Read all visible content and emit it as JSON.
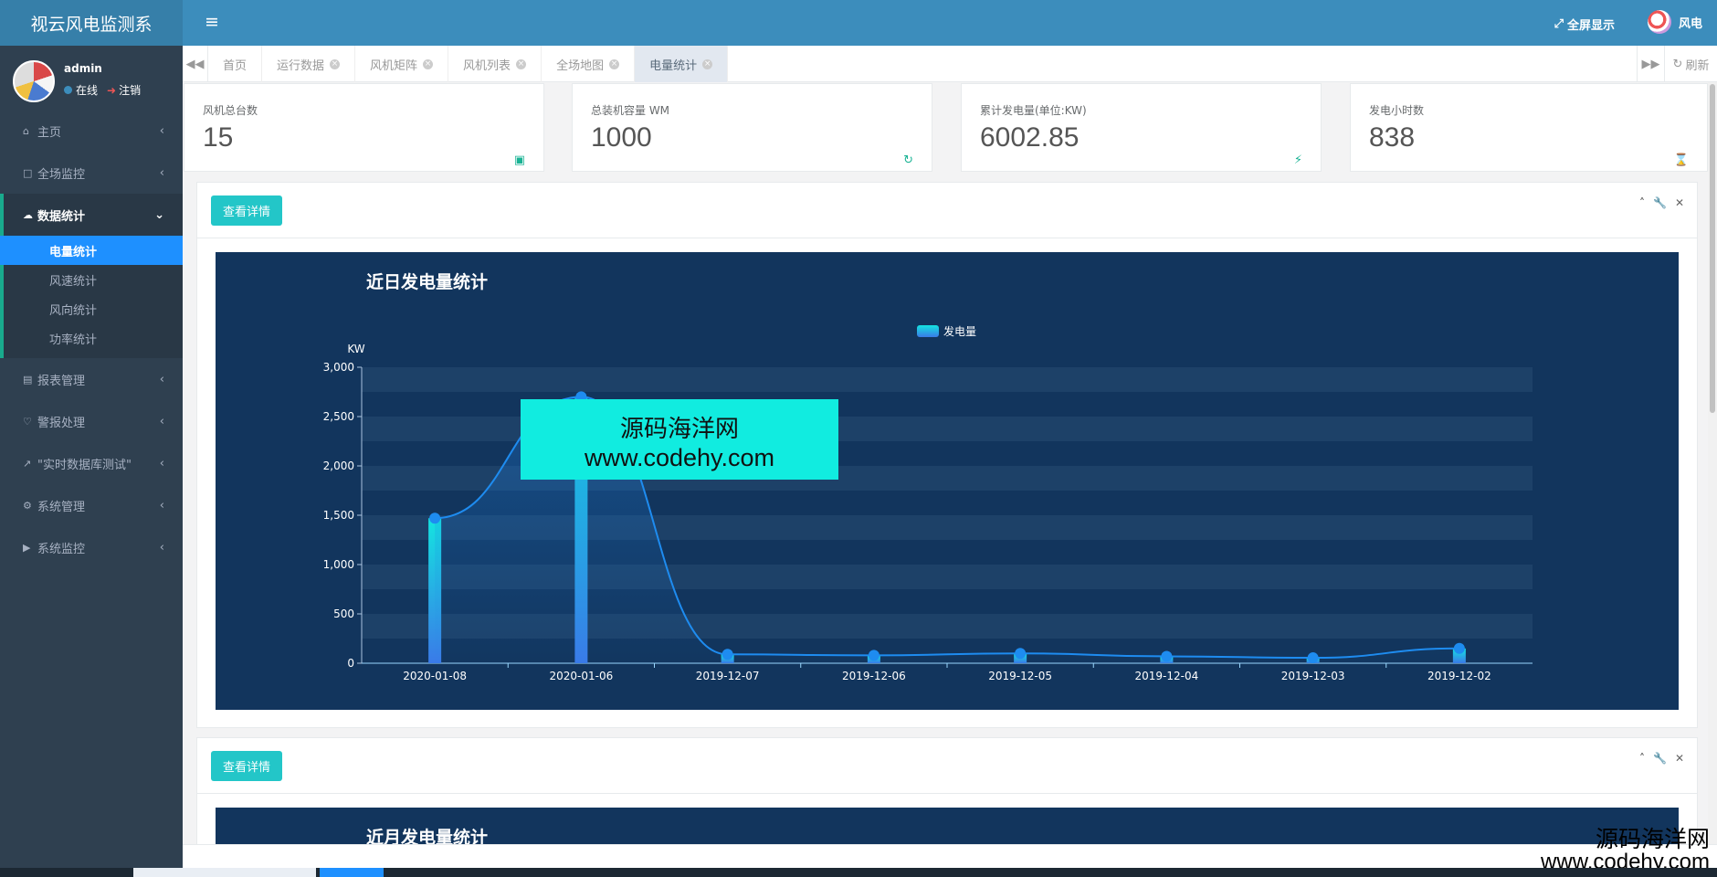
{
  "app": {
    "title": "视云风电监测系",
    "fullscreen_label": "全屏显示",
    "user_name": "风电"
  },
  "profile": {
    "name": "admin",
    "status": "在线",
    "logout": "注销"
  },
  "sidebar": {
    "items": [
      {
        "label": "主页",
        "icon": "home-icon"
      },
      {
        "label": "全场监控",
        "icon": "monitor-icon"
      },
      {
        "label": "数据统计",
        "icon": "cloud-icon",
        "active": true
      },
      {
        "label": "报表管理",
        "icon": "report-icon"
      },
      {
        "label": "警报处理",
        "icon": "bell-icon"
      },
      {
        "label": "\"实时数据库测试\"",
        "icon": "line-chart-icon"
      },
      {
        "label": "系统管理",
        "icon": "gear-icon"
      },
      {
        "label": "系统监控",
        "icon": "video-icon"
      }
    ],
    "sub_items": [
      "电量统计",
      "风速统计",
      "风向统计",
      "功率统计"
    ]
  },
  "tabs": [
    "首页",
    "运行数据",
    "风机矩阵",
    "风机列表",
    "全场地图",
    "电量统计"
  ],
  "refresh_label": "刷新",
  "stats": [
    {
      "label": "风机总台数",
      "value": "15",
      "icon": "image-icon"
    },
    {
      "label": "总装机容量 WM",
      "value": "1000",
      "icon": "refresh-icon"
    },
    {
      "label": "累计发电量(单位:KW)",
      "value": "6002.85",
      "icon": "bolt-icon"
    },
    {
      "label": "发电小时数",
      "value": "838",
      "icon": "hourglass-icon"
    }
  ],
  "panel1": {
    "button": "查看详情"
  },
  "panel2": {
    "button": "查看详情",
    "chart_title": "近月发电量统计"
  },
  "watermark": {
    "line1": "源码海洋网",
    "line2": "www.codehy.com"
  },
  "colors": {
    "header": "#3c8dbc",
    "sidebar": "#2f4050",
    "chart_bg": "#12355d",
    "button": "#23c6c8",
    "accent": "#1e90ff"
  },
  "chart_data": {
    "type": "bar",
    "title": "近日发电量统计",
    "ylabel": "KW",
    "xlabel": "",
    "legend": "top-center",
    "categories": [
      "2020-01-08",
      "2020-01-06",
      "2019-12-07",
      "2019-12-06",
      "2019-12-05",
      "2019-12-04",
      "2019-12-03",
      "2019-12-02"
    ],
    "series": [
      {
        "name": "发电量",
        "values": [
          1470,
          2700,
          90,
          80,
          100,
          70,
          55,
          150
        ]
      }
    ],
    "ylim": [
      0,
      3000
    ],
    "yticks": [
      "0",
      "500",
      "1,000",
      "1,500",
      "2,000",
      "2,500",
      "3,000"
    ],
    "grid": true
  }
}
